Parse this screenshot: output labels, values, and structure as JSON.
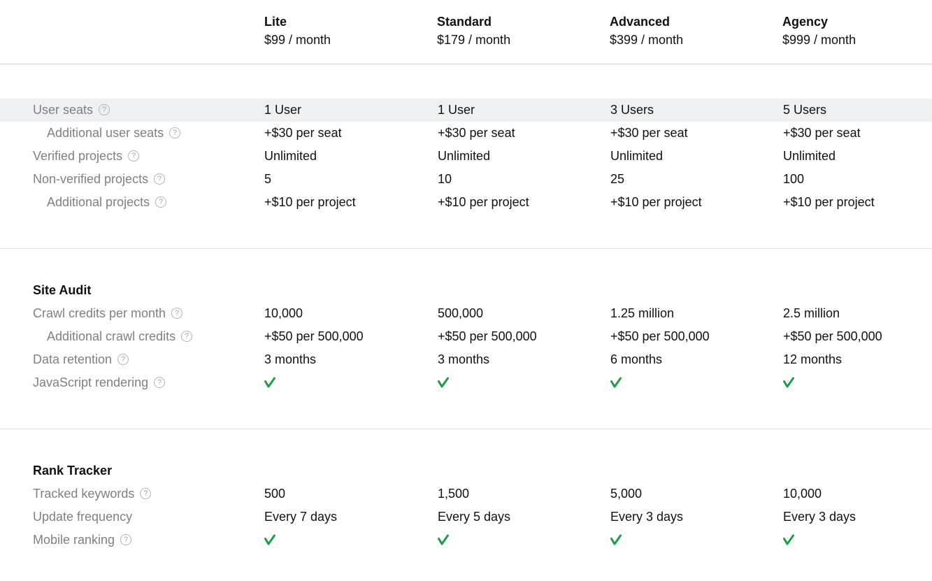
{
  "plans": [
    {
      "name": "Lite",
      "price": "$99 / month"
    },
    {
      "name": "Standard",
      "price": "$179 / month"
    },
    {
      "name": "Advanced",
      "price": "$399 / month"
    },
    {
      "name": "Agency",
      "price": "$999 / month"
    }
  ],
  "help_icon_glyph": "?",
  "colors": {
    "check": "#1a9e46",
    "highlight_row": "#eff0f2",
    "label": "#808083"
  },
  "general": {
    "rows": [
      {
        "label": "User seats",
        "values": [
          "1 User",
          "1 User",
          "3 Users",
          "5 Users"
        ]
      },
      {
        "label": "Additional user seats",
        "values": [
          "+$30 per seat",
          "+$30 per seat",
          "+$30 per seat",
          "+$30 per seat"
        ]
      },
      {
        "label": "Verified projects",
        "values": [
          "Unlimited",
          "Unlimited",
          "Unlimited",
          "Unlimited"
        ]
      },
      {
        "label": "Non-verified projects",
        "values": [
          "5",
          "10",
          "25",
          "100"
        ]
      },
      {
        "label": "Additional projects",
        "values": [
          "+$10 per project",
          "+$10 per project",
          "+$10 per project",
          "+$10 per project"
        ]
      }
    ]
  },
  "site_audit": {
    "title": "Site Audit",
    "rows": [
      {
        "label": "Crawl credits per month",
        "values": [
          "10,000",
          "500,000",
          "1.25 million",
          "2.5 million"
        ]
      },
      {
        "label": "Additional crawl credits",
        "values": [
          "+$50 per 500,000",
          "+$50 per 500,000",
          "+$50 per 500,000",
          "+$50 per 500,000"
        ]
      },
      {
        "label": "Data retention",
        "values": [
          "3 months",
          "3 months",
          "6 months",
          "12 months"
        ]
      },
      {
        "label": "JavaScript rendering",
        "included": [
          true,
          true,
          true,
          true
        ],
        "icon": "checkmark-icon"
      }
    ]
  },
  "rank_tracker": {
    "title": "Rank Tracker",
    "rows": [
      {
        "label": "Tracked keywords",
        "values": [
          "500",
          "1,500",
          "5,000",
          "10,000"
        ]
      },
      {
        "label": "Update frequency",
        "values": [
          "Every 7 days",
          "Every 5 days",
          "Every 3 days",
          "Every 3 days"
        ]
      },
      {
        "label": "Mobile ranking",
        "included": [
          true,
          true,
          true,
          true
        ],
        "icon": "checkmark-icon"
      }
    ]
  }
}
